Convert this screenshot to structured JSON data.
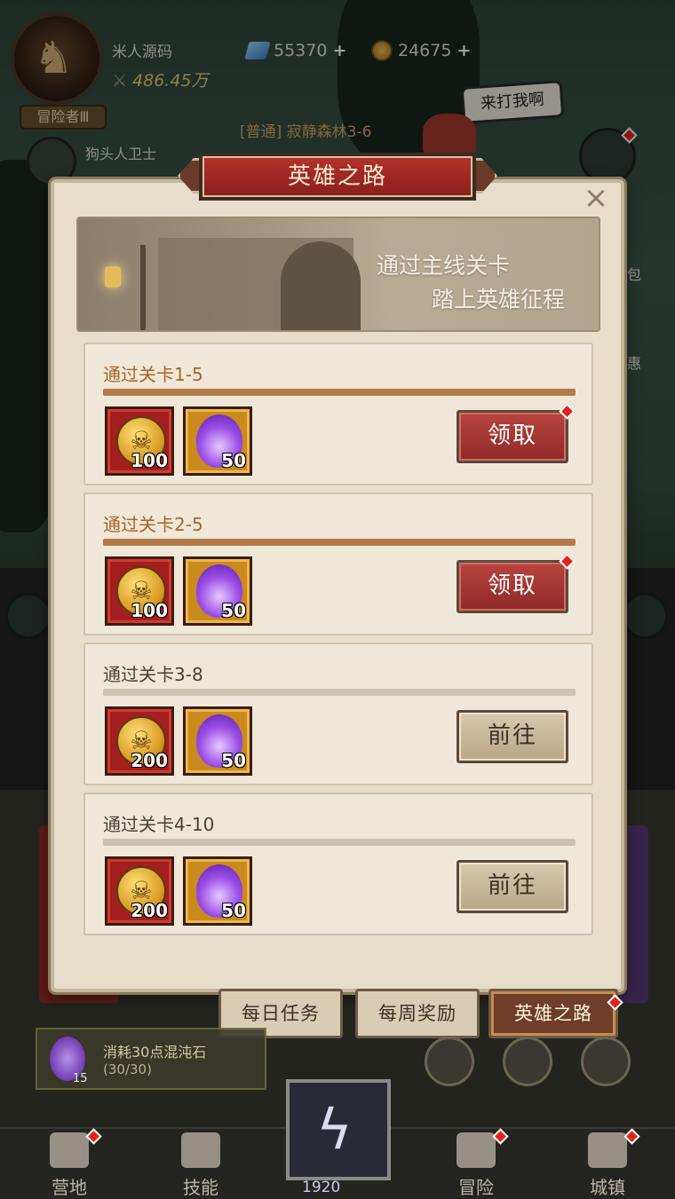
{
  "hud": {
    "player_name": "米人源码",
    "power": "486.45万",
    "rank": "冒险者Ⅲ",
    "gems": "55370",
    "coins": "24675",
    "enemy_name": "狗头人卫士",
    "stage": "[普通] 寂静森林3-6",
    "speech": "来打我啊",
    "side_labels": [
      "包",
      "惠"
    ]
  },
  "panel": {
    "title": "英雄之路",
    "close": "×",
    "banner_line1": "通过主线关卡",
    "banner_line2": "踏上英雄征程"
  },
  "tasks": [
    {
      "title": "通过关卡1-5",
      "coin_qty": "100",
      "flame_qty": "50",
      "action": "领取",
      "state": "claim",
      "badge": true
    },
    {
      "title": "通过关卡2-5",
      "coin_qty": "100",
      "flame_qty": "50",
      "action": "领取",
      "state": "claim",
      "badge": true
    },
    {
      "title": "通过关卡3-8",
      "coin_qty": "200",
      "flame_qty": "50",
      "action": "前往",
      "state": "go",
      "badge": false
    },
    {
      "title": "通过关卡4-10",
      "coin_qty": "200",
      "flame_qty": "50",
      "action": "前往",
      "state": "go",
      "badge": false
    }
  ],
  "tabs": [
    {
      "label": "每日任务",
      "active": false
    },
    {
      "label": "每周奖励",
      "active": false
    },
    {
      "label": "英雄之路",
      "active": true
    }
  ],
  "bottom": {
    "task_text": "消耗30点混沌石",
    "task_progress": "(30/30)",
    "task_count": "15",
    "center_value": "1920",
    "nav": [
      "营地",
      "技能",
      "冒险",
      "城镇"
    ]
  },
  "colors": {
    "accent_red": "#b3322c",
    "done_title": "#a8642c",
    "pending_title": "#4a4036",
    "done_bar": "#b47a4a",
    "pending_bar": "#cbc2b0"
  },
  "icons": {
    "coin": "skull-coin-icon",
    "flame": "chaos-flame-icon",
    "close": "close-icon",
    "gem": "gem-icon"
  }
}
